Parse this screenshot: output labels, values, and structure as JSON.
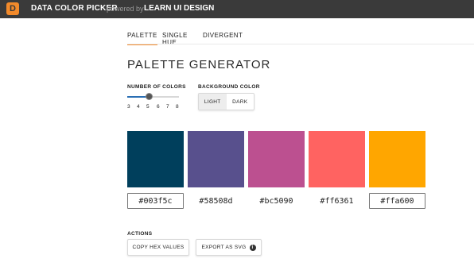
{
  "topbar": {
    "logo_letter": "D",
    "brand": "DATA COLOR PICKER",
    "powered": "powered by",
    "brand2": "LEARN UI DESIGN"
  },
  "tabs": [
    {
      "label": "PALETTE",
      "active": true
    },
    {
      "label": "SINGLE HUE",
      "active": false
    },
    {
      "label": "DIVERGENT",
      "active": false
    }
  ],
  "page_title": "PALETTE GENERATOR",
  "number_of_colors": {
    "label": "NUMBER OF COLORS",
    "ticks": [
      "3",
      "4",
      "5",
      "6",
      "7",
      "8"
    ],
    "selected": "5"
  },
  "background_color": {
    "label": "BACKGROUND COLOR",
    "options": [
      "LIGHT",
      "DARK"
    ],
    "selected": "LIGHT"
  },
  "swatches": [
    {
      "color": "#003f5c",
      "hex": "#003f5c"
    },
    {
      "color": "#58508d",
      "hex": "#58508d"
    },
    {
      "color": "#bc5090",
      "hex": "#bc5090"
    },
    {
      "color": "#ff6361",
      "hex": "#ff6361"
    },
    {
      "color": "#ffa600",
      "hex": "#ffa600"
    }
  ],
  "actions": {
    "label": "ACTIONS",
    "copy_hex": "COPY HEX VALUES",
    "export_svg": "EXPORT AS SVG",
    "info_icon": "info-icon"
  },
  "accent": "#f28a2b"
}
